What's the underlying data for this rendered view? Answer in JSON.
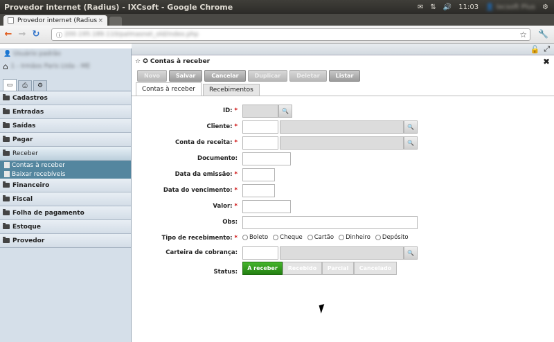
{
  "os": {
    "window_title": "Provedor internet (Radius) - IXCsoft - Google Chrome",
    "time": "11:03",
    "user": "Ixcsoft Plus"
  },
  "browser": {
    "tab_title": "Provedor internet (Radius",
    "url": "200.195.189.110/palmasnet_old/index.php"
  },
  "sidebar": {
    "user_name": "Usuário padrão",
    "company": "1 - Irmãos Paris Ltda - ME",
    "items": [
      {
        "label": "Cadastros"
      },
      {
        "label": "Entradas"
      },
      {
        "label": "Saídas"
      },
      {
        "label": "Pagar"
      },
      {
        "label": "Receber"
      }
    ],
    "subitems": [
      {
        "label": "Contas à receber"
      },
      {
        "label": "Baixar recebíveis"
      }
    ],
    "items_after": [
      {
        "label": "Financeiro"
      },
      {
        "label": "Fiscal"
      },
      {
        "label": "Folha de pagamento"
      },
      {
        "label": "Estoque"
      },
      {
        "label": "Provedor"
      }
    ]
  },
  "form": {
    "title": "Contas à receber",
    "toolbar": {
      "novo": "Novo",
      "salvar": "Salvar",
      "cancelar": "Cancelar",
      "duplicar": "Duplicar",
      "deletar": "Deletar",
      "listar": "Listar"
    },
    "tabs": {
      "contas": "Contas à receber",
      "recebimentos": "Recebimentos"
    },
    "labels": {
      "id": "ID:",
      "cliente": "Cliente:",
      "conta_receita": "Conta de receita:",
      "documento": "Documento:",
      "data_emissao": "Data da emissão:",
      "data_vencimento": "Data do vencimento:",
      "valor": "Valor:",
      "obs": "Obs:",
      "tipo_recebimento": "Tipo de recebimento:",
      "carteira": "Carteira de cobrança:",
      "status": "Status:"
    },
    "required_mark": "*",
    "tipo_options": [
      "Boleto",
      "Cheque",
      "Cartão",
      "Dinheiro",
      "Depósito"
    ],
    "status_options": [
      "À receber",
      "Recebido",
      "Parcial",
      "Cancelado"
    ]
  },
  "colors": {
    "status_active": "#2f9a1c",
    "sidebar_selected": "#54869f"
  }
}
